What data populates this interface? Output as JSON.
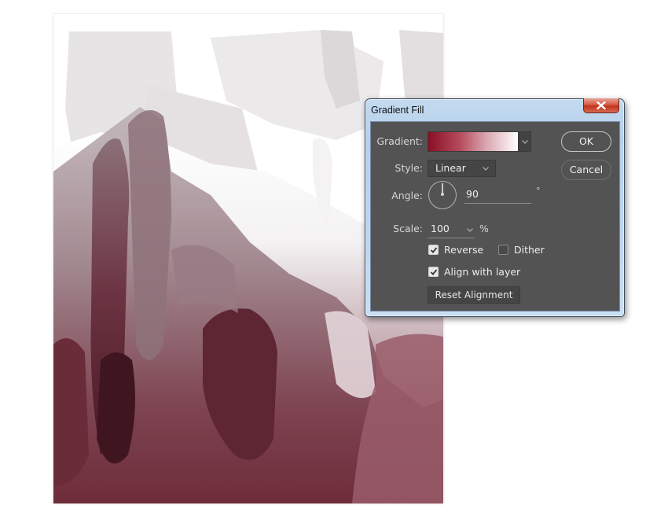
{
  "canvas": {
    "description": "watercolor-texture artwork with gradient fill from light grey-white at top to maroon at bottom",
    "colors": {
      "top": "#f1f0f1",
      "light_mauve": "#d7cbcf",
      "mauve": "#a88590",
      "dark": "#6d2f3d",
      "darkest": "#3f1620"
    }
  },
  "dialog": {
    "title": "Gradient Fill",
    "close_icon": "close-icon",
    "gradient": {
      "label": "Gradient:",
      "start_color": "#8a0f25",
      "end_color": "#ffffff"
    },
    "style": {
      "label": "Style:",
      "value": "Linear"
    },
    "angle": {
      "label": "Angle:",
      "value": "90",
      "unit": "°"
    },
    "scale": {
      "label": "Scale:",
      "value": "100",
      "unit": "%"
    },
    "checkboxes": {
      "reverse": {
        "label": "Reverse",
        "checked": true
      },
      "dither": {
        "label": "Dither",
        "checked": false
      },
      "align": {
        "label": "Align with layer",
        "checked": true
      }
    },
    "reset_label": "Reset Alignment",
    "ok_label": "OK",
    "cancel_label": "Cancel"
  }
}
